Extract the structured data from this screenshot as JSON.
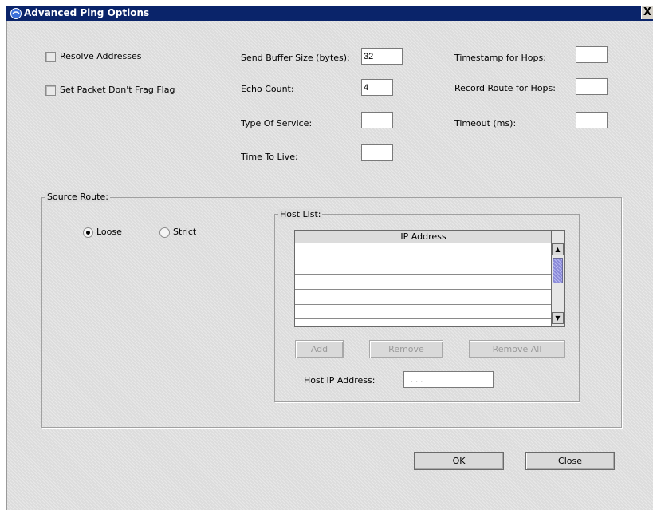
{
  "window": {
    "title": "Advanced Ping Options",
    "close_label": "X"
  },
  "options": {
    "resolve_addresses": "Resolve Addresses",
    "dont_frag": "Set Packet Don't Frag Flag",
    "send_buffer_label": "Send Buffer Size (bytes):",
    "send_buffer_value": "32",
    "echo_count_label": "Echo Count:",
    "echo_count_value": "4",
    "tos_label": "Type Of Service:",
    "tos_value": "",
    "ttl_label": "Time To Live:",
    "ttl_value": "",
    "timestamp_label": "Timestamp for Hops:",
    "timestamp_value": "",
    "record_route_label": "Record Route for Hops:",
    "record_route_value": "",
    "timeout_label": "Timeout (ms):",
    "timeout_value": ""
  },
  "source_route": {
    "legend": "Source Route:",
    "loose_label": "Loose",
    "strict_label": "Strict",
    "selected": "Loose"
  },
  "host_list": {
    "legend": "Host List:",
    "column_header": "IP Address",
    "rows": [
      "",
      "",
      "",
      "",
      ""
    ],
    "add_label": "Add",
    "remove_label": "Remove",
    "remove_all_label": "Remove All",
    "host_ip_label": "Host IP Address:",
    "host_ip_value": ". . ."
  },
  "footer": {
    "ok_label": "OK",
    "close_label": "Close"
  }
}
